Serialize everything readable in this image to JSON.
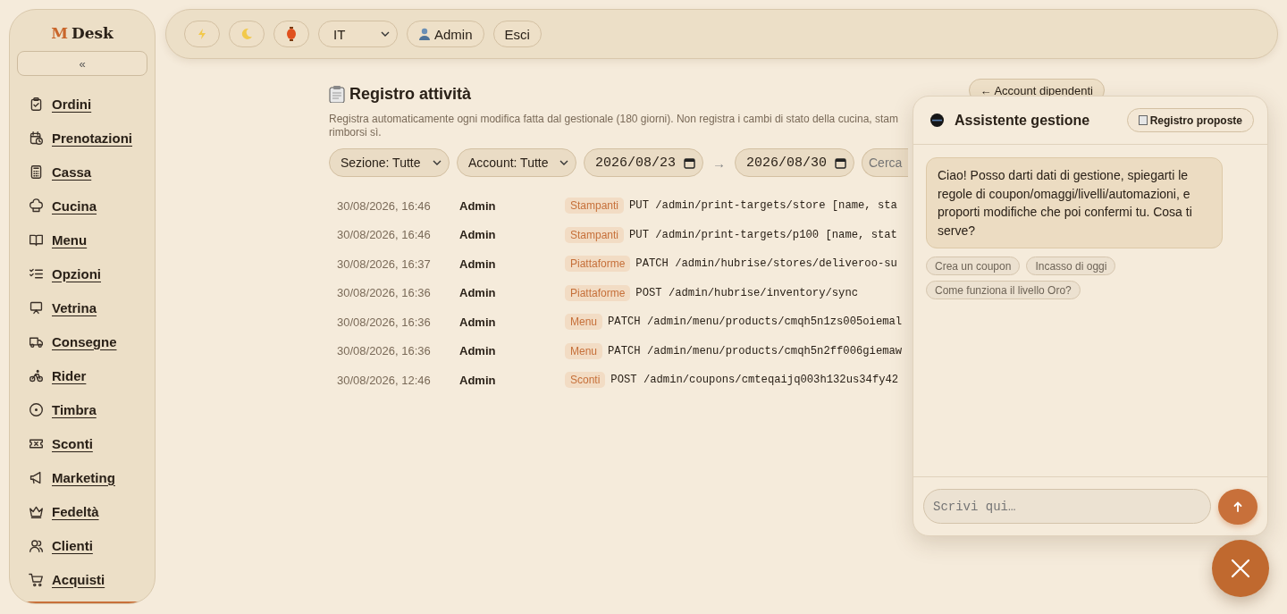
{
  "sidebar": {
    "logo": {
      "mark": "M",
      "name": "Desk"
    },
    "collapse": "«",
    "items": [
      {
        "label": "Ordini",
        "selected": false
      },
      {
        "label": "Prenotazioni",
        "selected": false
      },
      {
        "label": "Cassa",
        "selected": false
      },
      {
        "label": "Cucina",
        "selected": false
      },
      {
        "label": "Menu",
        "selected": false
      },
      {
        "label": "Opzioni",
        "selected": false
      },
      {
        "label": "Vetrina",
        "selected": false
      },
      {
        "label": "Consegne",
        "selected": false
      },
      {
        "label": "Rider",
        "selected": false
      },
      {
        "label": "Timbra",
        "selected": false
      },
      {
        "label": "Sconti",
        "selected": false
      },
      {
        "label": "Marketing",
        "selected": false
      },
      {
        "label": "Fedeltà",
        "selected": false
      },
      {
        "label": "Clienti",
        "selected": false
      },
      {
        "label": "Acquisti",
        "selected": false
      },
      {
        "selected": true
      }
    ]
  },
  "topbar": {
    "language": "IT",
    "user": "Admin",
    "logout": "Esci"
  },
  "page": {
    "title": "Registro attività",
    "back": "← Account dipendenti",
    "description": [
      "Registra automaticamente ogni modifica fatta dal gestionale (180 giorni). Non registra i cambi di stato della cucina, stam",
      "rimborsi sì."
    ],
    "filters": {
      "section": "Sezione: Tutte",
      "account": "Account: Tutte",
      "from": "2026/08/23",
      "arrow": "→",
      "to": "2026/08/30",
      "search_placeholder": "Cerca"
    },
    "rows": [
      {
        "time": "30/08/2026, 16:46",
        "user": "Admin",
        "section": "Stampanti",
        "action": "PUT /admin/print-targets/store [name, sta"
      },
      {
        "time": "30/08/2026, 16:46",
        "user": "Admin",
        "section": "Stampanti",
        "action": "PUT /admin/print-targets/p100 [name, stat"
      },
      {
        "time": "30/08/2026, 16:37",
        "user": "Admin",
        "section": "Piattaforme",
        "action": "PATCH /admin/hubrise/stores/deliveroo-su"
      },
      {
        "time": "30/08/2026, 16:36",
        "user": "Admin",
        "section": "Piattaforme",
        "action": "POST /admin/hubrise/inventory/sync"
      },
      {
        "time": "30/08/2026, 16:36",
        "user": "Admin",
        "section": "Menu",
        "action": "PATCH /admin/menu/products/cmqh5n1zs005oiemal"
      },
      {
        "time": "30/08/2026, 16:36",
        "user": "Admin",
        "section": "Menu",
        "action": "PATCH /admin/menu/products/cmqh5n2ff006giemaw"
      },
      {
        "time": "30/08/2026, 12:46",
        "user": "Admin",
        "section": "Sconti",
        "action": "POST /admin/coupons/cmteqaijq003h132us34fy42"
      }
    ]
  },
  "assistant": {
    "title": "Assistente gestione",
    "log_button": "Registro proposte",
    "messages": [
      "Ciao! Posso darti dati di gestione, spiegarti le regole di coupon/omaggi/livelli/automazioni, e proporti modifiche che poi confermi tu. Cosa ti serve?"
    ],
    "suggestions": [
      "Crea un coupon",
      "Incasso di oggi",
      "Come funziona il livello Oro?"
    ],
    "input_placeholder": "Scrivi qui…"
  }
}
